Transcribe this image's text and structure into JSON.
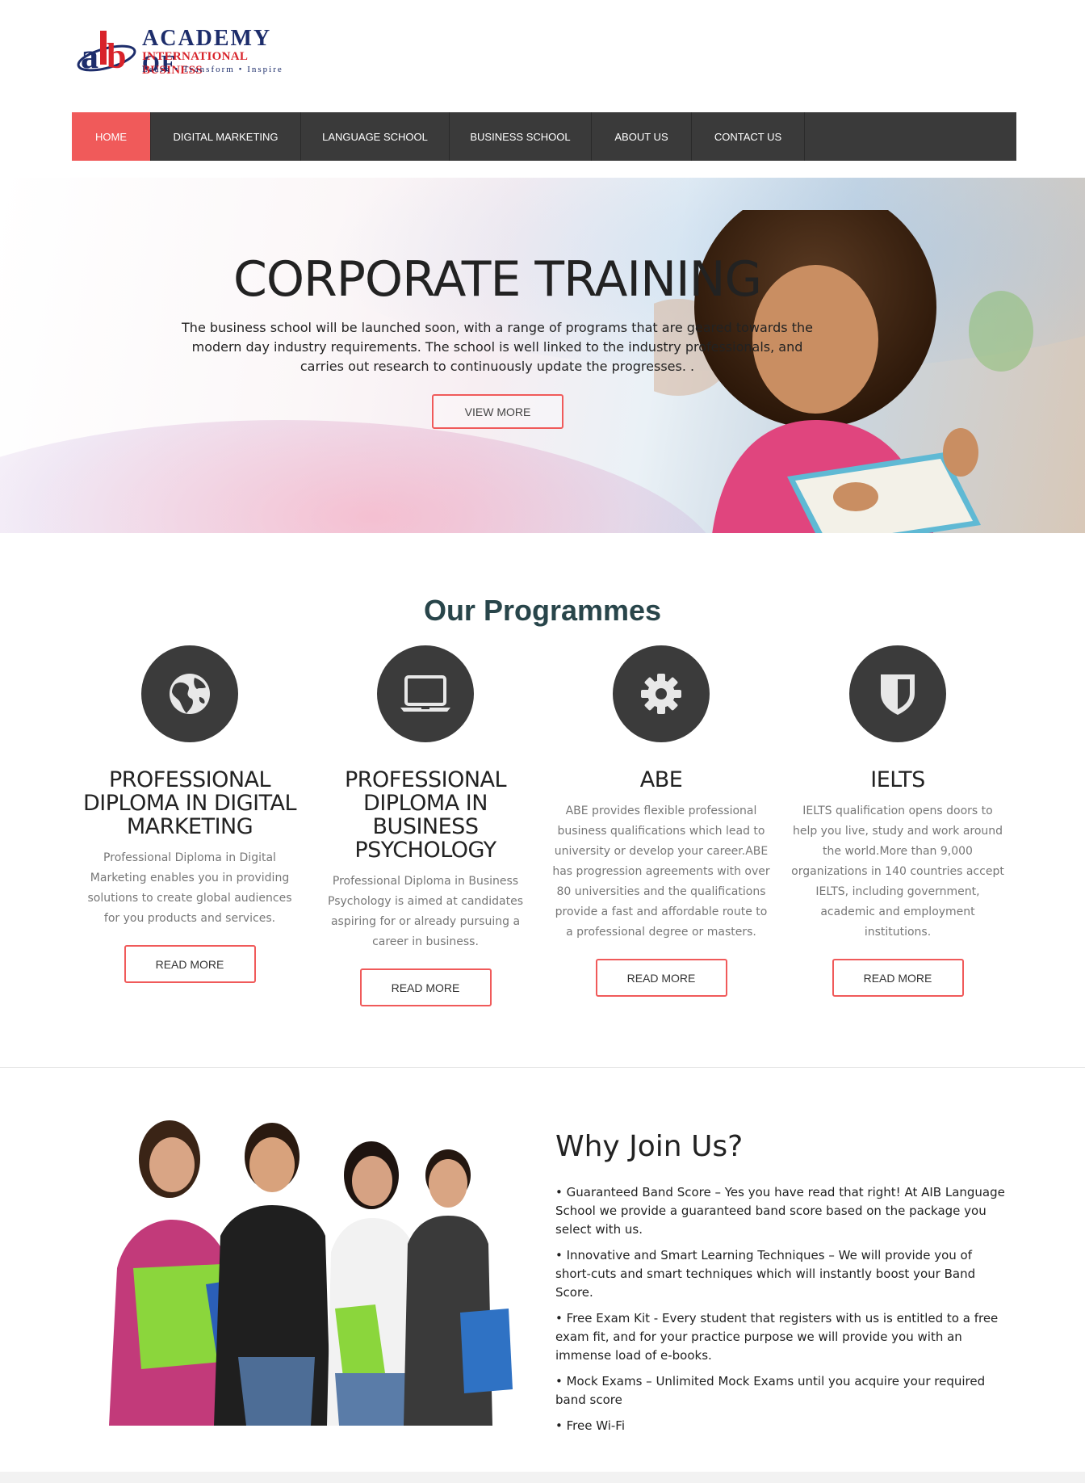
{
  "logo": {
    "line1": "ACADEMY OF",
    "line2": "INTERNATIONAL BUSINESS",
    "line3": "Learn • Transform • Inspire",
    "mark": "aib"
  },
  "nav": {
    "items": [
      {
        "label": "HOME",
        "active": true
      },
      {
        "label": "DIGITAL MARKETING"
      },
      {
        "label": "LANGUAGE SCHOOL"
      },
      {
        "label": "BUSINESS SCHOOL"
      },
      {
        "label": "ABOUT US"
      },
      {
        "label": "CONTACT US"
      }
    ]
  },
  "hero": {
    "title": "CORPORATE TRAINING",
    "text": "The business school will be launched soon, with a range of programs that are geared towards the modern day industry requirements. The school is well linked to the industry professionals, and carries out research to continuously update the progresses. .",
    "button": "VIEW MORE"
  },
  "programmes": {
    "title": "Our Programmes",
    "items": [
      {
        "icon": "globe-icon",
        "name": "PROFESSIONAL DIPLOMA IN DIGITAL MARKETING",
        "desc": "Professional Diploma in Digital Marketing enables you in providing solutions to create global audiences for you products and services.",
        "button": "READ MORE"
      },
      {
        "icon": "laptop-icon",
        "name": "PROFESSIONAL DIPLOMA IN BUSINESS PSYCHOLOGY",
        "desc": "Professional Diploma in Business Psychology is aimed at candidates aspiring for or already pursuing a career in business.",
        "button": "READ MORE"
      },
      {
        "icon": "gear-icon",
        "name": "ABE",
        "desc": "ABE provides flexible professional business qualifications which lead to university or develop your career.ABE has progression agreements with over 80 universities and the qualifications provide a fast and affordable route to a professional degree or masters.",
        "button": "READ MORE"
      },
      {
        "icon": "shield-icon",
        "name": "IELTS",
        "desc": "IELTS qualification opens doors to help you live, study and work around the world.More than 9,000 organizations in 140 countries accept IELTS, including government, academic and employment institutions.",
        "button": "READ MORE"
      }
    ]
  },
  "why": {
    "title": "Why Join Us?",
    "items": [
      "• Guaranteed Band Score – Yes you have read that right! At AIB Language School we provide a guaranteed band score based on the package you select with us.",
      "• Innovative and Smart Learning Techniques – We will provide you of short-cuts and smart techniques which will instantly boost your Band Score.",
      "• Free Exam Kit - Every student that registers with us is entitled to a free exam fit, and for your practice purpose we will provide you with an immense load of e-books.",
      "• Mock Exams – Unlimited Mock Exams until you acquire your required band score",
      "• Free Wi-Fi"
    ]
  },
  "colors": {
    "accent": "#f05a5a",
    "nav_bg": "#3a3a3a",
    "icon_bg": "#3b3b3b",
    "heading_teal": "#28454a",
    "logo_blue": "#1d2d6b",
    "logo_red": "#d8232a"
  }
}
